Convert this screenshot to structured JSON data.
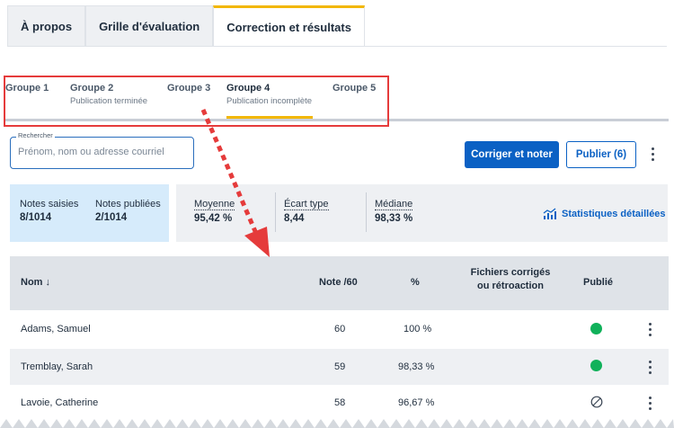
{
  "top_tabs": [
    {
      "label": "À propos",
      "active": false
    },
    {
      "label": "Grille d'évaluation",
      "active": false
    },
    {
      "label": "Correction et résultats",
      "active": true
    }
  ],
  "groups": [
    {
      "label": "Groupe 1",
      "sub": ""
    },
    {
      "label": "Groupe 2",
      "sub": "Publication terminée"
    },
    {
      "label": "Groupe 3",
      "sub": ""
    },
    {
      "label": "Groupe 4",
      "sub": "Publication incomplète",
      "active": true
    },
    {
      "label": "Groupe 5",
      "sub": ""
    }
  ],
  "search": {
    "legend": "Rechercher",
    "placeholder": "Prénom, nom ou adresse courriel"
  },
  "actions": {
    "grade_label": "Corriger et noter",
    "publish_label": "Publier (6)"
  },
  "stats": {
    "saisies_label": "Notes saisies",
    "saisies_value": "8/1014",
    "publiees_label": "Notes publiées",
    "publiees_value": "2/1014",
    "moyenne_label": "Moyenne",
    "moyenne_value": "95,42 %",
    "ecart_label": "Écart type",
    "ecart_value": "8,44",
    "mediane_label": "Médiane",
    "mediane_value": "98,33 %",
    "details_link": "Statistiques détaillées"
  },
  "table": {
    "headers": {
      "name": "Nom ↓",
      "note": "Note /60",
      "pct": "%",
      "files_line1": "Fichiers corrigés",
      "files_line2": "ou rétroaction",
      "published": "Publié"
    },
    "rows": [
      {
        "name": "Adams, Samuel",
        "note": "60",
        "pct": "100 %",
        "published": "green"
      },
      {
        "name": "Tremblay, Sarah",
        "note": "59",
        "pct": "98,33 %",
        "published": "green"
      },
      {
        "name": "Lavoie, Catherine",
        "note": "58",
        "pct": "96,67 %",
        "published": "none"
      }
    ]
  },
  "colors": {
    "accent": "#f2b705",
    "primary": "#0b61c4",
    "annotation": "#e53b3b",
    "published": "#10b15a"
  },
  "icons": {
    "stats": "chart-icon",
    "menu": "kebab-menu-icon",
    "unpublished": "not-published-icon"
  }
}
